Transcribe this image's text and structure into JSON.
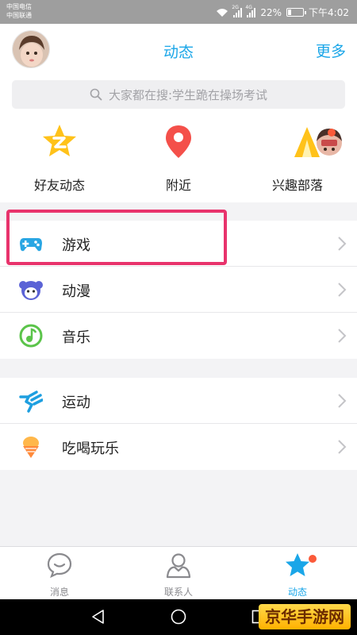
{
  "status_bar": {
    "carrier1": "中国电信",
    "carrier2": "中国联通",
    "net1": "2G",
    "net2": "4G",
    "battery_text": "22%",
    "battery_level": 0.22,
    "time": "下午4:02"
  },
  "header": {
    "title": "动态",
    "more": "更多"
  },
  "search": {
    "placeholder": "大家都在搜:学生跪在操场考试"
  },
  "features": [
    {
      "label": "好友动态",
      "icon": "friends-star-icon"
    },
    {
      "label": "附近",
      "icon": "location-pin-icon"
    },
    {
      "label": "兴趣部落",
      "icon": "tribe-tent-icon"
    }
  ],
  "list1": [
    {
      "label": "游戏",
      "icon": "gamepad-icon"
    },
    {
      "label": "动漫",
      "icon": "anime-icon"
    },
    {
      "label": "音乐",
      "icon": "music-icon"
    }
  ],
  "list2": [
    {
      "label": "运动",
      "icon": "running-icon"
    },
    {
      "label": "吃喝玩乐",
      "icon": "icecream-icon"
    }
  ],
  "tabs": [
    {
      "label": "消息",
      "icon": "message-icon"
    },
    {
      "label": "联系人",
      "icon": "contacts-icon"
    },
    {
      "label": "动态",
      "icon": "star-icon"
    }
  ],
  "watermark": "京华手游网",
  "colors": {
    "accent": "#1aa6e8",
    "highlight": "#e8336c",
    "badge": "#fb5a3a",
    "music_green": "#5bc44a",
    "location_red": "#f4504a",
    "star_yellow": "#ffc21a"
  }
}
